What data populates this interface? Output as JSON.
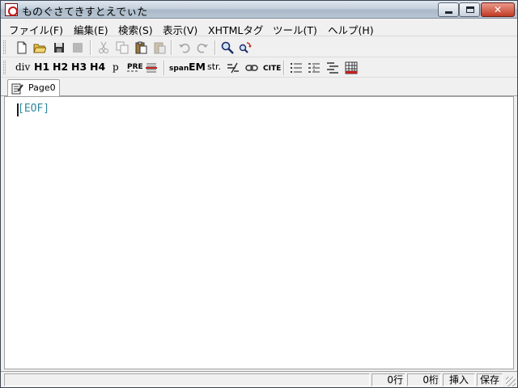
{
  "window": {
    "title": "ものぐさてきすとえでぃた",
    "controls": {
      "minimize": "minimize",
      "maximize": "maximize",
      "close": "✕"
    }
  },
  "menu": [
    "ファイル(F)",
    "編集(E)",
    "検索(S)",
    "表示(V)",
    "XHTMLタグ",
    "ツール(T)",
    "ヘルプ(H)"
  ],
  "toolbar1": {
    "icons": [
      "new-file",
      "open-folder",
      "save",
      "save-all",
      "cut",
      "copy",
      "paste",
      "paste-special",
      "undo",
      "redo",
      "find",
      "replace"
    ]
  },
  "toolbar2": {
    "labels": {
      "div": "div",
      "h1": "H1",
      "h2": "H2",
      "h3": "H3",
      "h4": "H4",
      "p": "p",
      "pre": "PRE",
      "span": "span",
      "em": "EM",
      "strong": "str.",
      "cite": "CITE"
    },
    "icons": [
      "pre-icon",
      "hr-icon",
      "line-break-icon",
      "link-icon",
      "ul-list-icon",
      "ol-list-icon",
      "dl-list-icon",
      "table-icon"
    ]
  },
  "tabs": [
    {
      "label": "Page0",
      "active": true
    }
  ],
  "editor": {
    "eof_marker": "[EOF]"
  },
  "status": {
    "message": "",
    "line": "0行",
    "column": "0桁",
    "mode": "挿入",
    "save_state": "保存"
  },
  "colors": {
    "eof": "#2f8a9c",
    "close_button": "#c13b24",
    "title_bar": "#c5d1dd"
  }
}
